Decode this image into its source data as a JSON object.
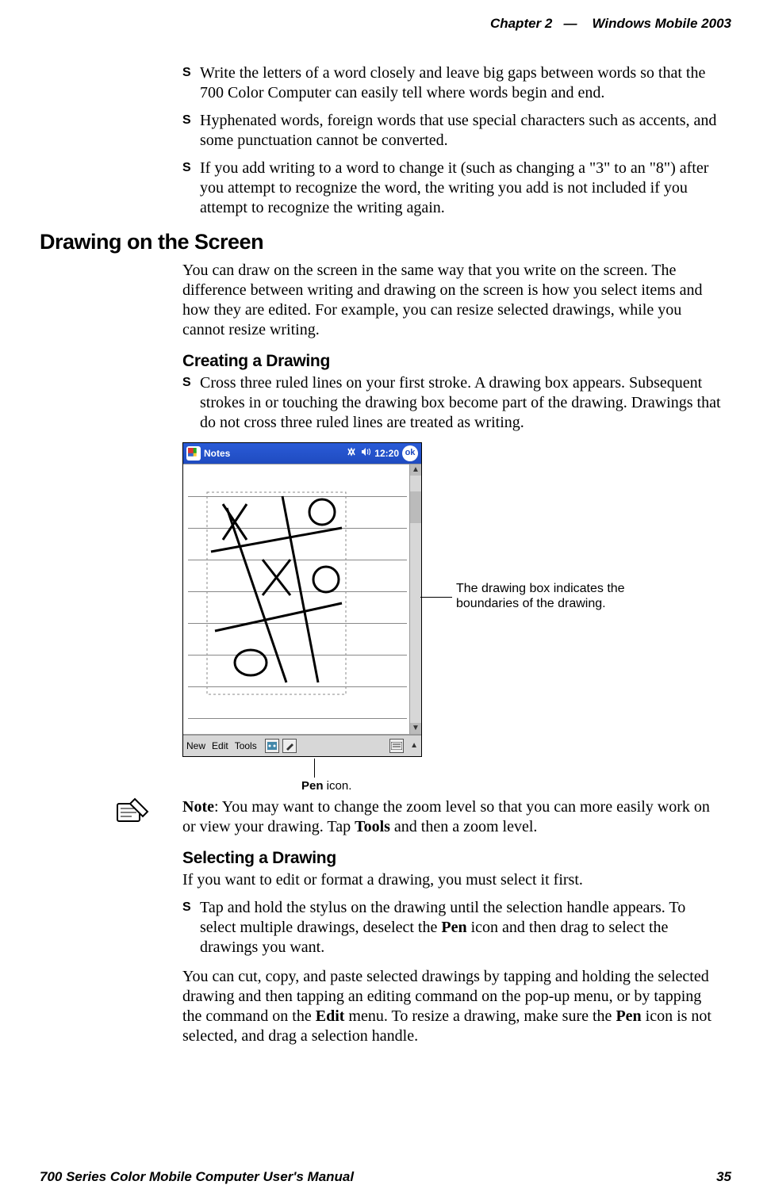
{
  "header": {
    "chapter_label": "Chapter",
    "chapter_number": "2",
    "sep": "—",
    "title": "Windows Mobile 2003"
  },
  "top_bullets": [
    "Write the letters of a word closely and leave big gaps between words so that the 700 Color Computer can easily tell where words begin and end.",
    "Hyphenated words, foreign words that use special characters such as accents, and some punctuation cannot be converted.",
    "If you add writing to a word to change it (such as changing a \"3\" to an \"8\") after you attempt to recognize the word, the writing you add is not included if you attempt to recognize the writing again."
  ],
  "section_heading": "Drawing on the Screen",
  "section_para": "You can draw on the screen in the same way that you write on the screen. The difference between writing and drawing on the screen is how you select items and how they are edited. For example, you can resize selected drawings, while you cannot resize writing.",
  "sub1_heading": "Creating a Drawing",
  "sub1_bullets": [
    "Cross three ruled lines on your first stroke. A drawing box appears. Subsequent strokes in or touching the drawing box become part of the drawing. Drawings that do not cross three ruled lines are treated as writing."
  ],
  "figure": {
    "app_title": "Notes",
    "clock": "12:20",
    "ok": "ok",
    "toolbar": {
      "new": "New",
      "edit": "Edit",
      "tools": "Tools"
    },
    "annotation": "The drawing box indicates the boundaries of the drawing.",
    "pen_label_bold": "Pen",
    "pen_label_rest": " icon."
  },
  "note_bold": "Note",
  "note_text": ": You may want to change the zoom level so that you can more easily work on or view your drawing. Tap ",
  "note_tools": "Tools",
  "note_text2": " and then a zoom level.",
  "sub2_heading": "Selecting a Drawing",
  "sub2_intro": "If you want to edit or format a drawing, you must select it first.",
  "sub2_bullets_pre": "Tap and hold the stylus on the drawing until the selection handle appears. To select multiple drawings, deselect the ",
  "sub2_pen": "Pen",
  "sub2_bullets_post": " icon and then drag to select the drawings you want.",
  "closing_pre": "You can cut, copy, and paste selected drawings by tapping and holding the selected drawing and then tapping an editing command on the pop-up menu, or by tapping the command on the ",
  "closing_edit": "Edit",
  "closing_mid": " menu. To resize a drawing, make sure the ",
  "closing_pen": "Pen",
  "closing_post": " icon is not selected, and drag a selection handle.",
  "footer": {
    "manual": "700 Series Color Mobile Computer User's Manual",
    "page": "35"
  }
}
